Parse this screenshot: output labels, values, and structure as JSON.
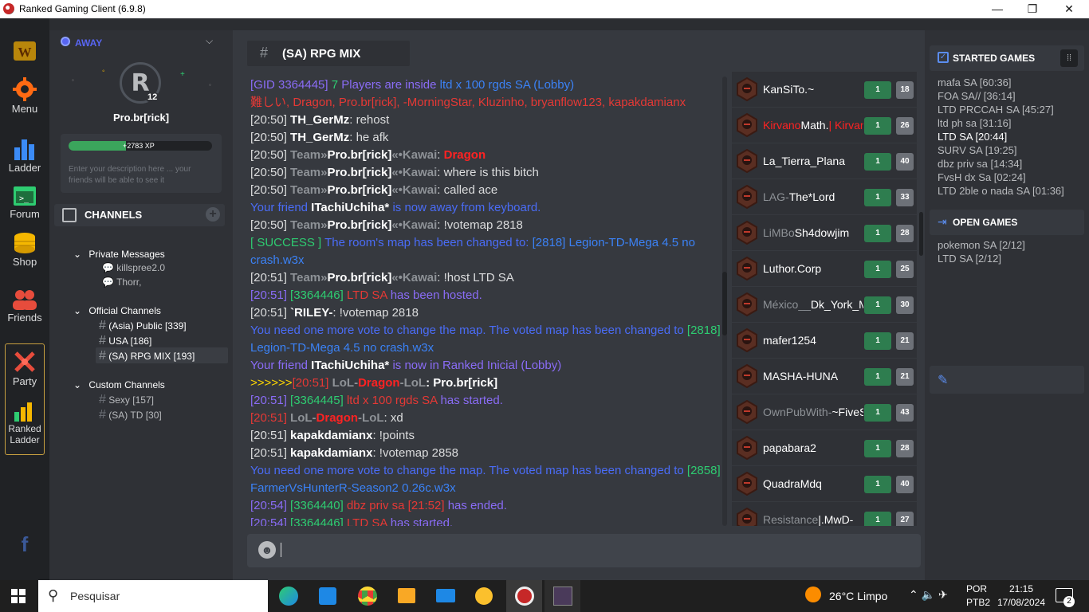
{
  "window": {
    "title": "Ranked Gaming Client (6.9.8)",
    "controls": [
      "—",
      "❐",
      "✕"
    ]
  },
  "nav": {
    "menu_label": "Menu",
    "ladder_label": "Ladder",
    "forum_label": "Forum",
    "shop_label": "Shop",
    "friends_label": "Friends",
    "party_label": "Party",
    "ranked_ladder_label_1": "Ranked",
    "ranked_ladder_label_2": "Ladder"
  },
  "profile": {
    "status": "AWAY",
    "name": "Pro.br[rick]",
    "level": "12",
    "xp": "+2783 XP",
    "xp_fraction": 0.4,
    "description_placeholder": "Enter your description here ... your friends will be able to see it"
  },
  "channels": {
    "header": "CHANNELS",
    "private_header": "Private Messages",
    "private": [
      "killspree2.0",
      "Thorr,"
    ],
    "official_header": "Official Channels",
    "official": [
      "(Asia) Public [339]",
      "USA [186]",
      "(SA) RPG MIX [193]"
    ],
    "custom_header": "Custom Channels",
    "custom": [
      "Sexy [157]",
      "(SA) TD [30]"
    ]
  },
  "chat": {
    "tab_title": "(SA) RPG MIX",
    "l1_a": "[GID 3364445]",
    "l1_b": "7",
    "l1_c": "Players are inside",
    "l1_d": "ltd x 100 rgds SA (Lobby)",
    "l2": "難しい, Dragon, Pro.br[rick], -MorningStar, Kluzinho, bryanflow123, kapakdamianx",
    "l3_t": "[20:50]",
    "l3_n": "TH_GerMz",
    "l3_m": ": rehost",
    "l4_t": "[20:50]",
    "l4_n": "TH_GerMz",
    "l4_m": ": he afk",
    "team": "Team»",
    "me": "Pro.br[rick]",
    "kawai": "«•Kawai",
    "l5_t": "[20:50]",
    "l5_m": "Dragon",
    "l6_t": "[20:50]",
    "l6_m": ": where is this bitch",
    "l7_t": "[20:50]",
    "l7_m": ": called ace",
    "l8_a": "Your friend",
    "l8_n": "ITachiUchiha*",
    "l8_b": "is now away from keyboard.",
    "l9_t": "[20:50]",
    "l9_m": ": !votemap 2818",
    "l10_a": "[ SUCCESS ]",
    "l10_b": "The room's map has been changed to:",
    "l10_c": "[2818] Legion-TD-Mega 4.5 no crash.w3x",
    "l11_t": "[20:51]",
    "l11_m": ": !host LTD SA",
    "l12_t": "[20:51]",
    "l12_g": "[3364446]",
    "l12_n": "LTD SA",
    "l12_m": "has been hosted.",
    "l13_t": "[20:51]",
    "l13_n": "`RILEY-",
    "l13_m": ": !votemap 2818",
    "l14_a": "You need one more vote to change the map. The voted map has been changed to",
    "l14_b": "[2818]",
    "l14_c": "Legion-TD-Mega 4.5 no crash.w3x",
    "l15_a": "Your friend",
    "l15_n": "ITachiUchiha*",
    "l15_b": "is now in Ranked Inicial (Lobby)",
    "l16_a": ">>>>>>",
    "l16_t": "[20:51]",
    "l16_n1": "LoL-",
    "l16_n2": "Dragon",
    "l16_n3": "-LoL",
    "l16_m": ": Pro.br[rick]",
    "l17_t": "[20:51]",
    "l17_g": "[3364445]",
    "l17_n": "ltd x 100 rgds SA",
    "l17_m": "has started.",
    "l18_t": "[20:51]",
    "l18_n1": "LoL-",
    "l18_n2": "Dragon",
    "l18_n3": "-LoL",
    "l18_m": ": xd",
    "l19_t": "[20:51]",
    "l19_n": "kapakdamianx",
    "l19_m": ": !points",
    "l20_t": "[20:51]",
    "l20_n": "kapakdamianx",
    "l20_m": ": !votemap 2858",
    "l21_a": "You need one more vote to change the map. The voted map has been changed to",
    "l21_b": "[2858]",
    "l21_c": "FarmerVsHunterR-Season2 0.26c.w3x",
    "l22_t": "[20:54]",
    "l22_g": "[3364440]",
    "l22_n": "dbz priv sa [21:52]",
    "l22_m": "has ended.",
    "l23_t": "[20:54]",
    "l23_g": "[3364446]",
    "l23_n": "LTD SA",
    "l23_m": "has started."
  },
  "users": [
    {
      "name": "KanSiTo.~",
      "a": "1",
      "b": "18"
    },
    {
      "name_red": "Kirvano",
      "name": "Math.",
      "name_red2": "| Kirvan",
      "a": "1",
      "b": "26"
    },
    {
      "name": "La_Tierra_Plana",
      "a": "1",
      "b": "40"
    },
    {
      "name_gray": "LAG-",
      "name": "The*Lord",
      "a": "1",
      "b": "33"
    },
    {
      "name_gray": "LiMBo",
      "name": "Sh4dowjim",
      "a": "1",
      "b": "28"
    },
    {
      "name": "Luthor.Corp",
      "a": "1",
      "b": "25"
    },
    {
      "name_gray": "México__",
      "name": "Dk_York_M",
      "a": "1",
      "b": "30"
    },
    {
      "name": "mafer1254",
      "a": "1",
      "b": "21"
    },
    {
      "name": "MASHA-HUNA",
      "a": "1",
      "b": "21"
    },
    {
      "name_gray": "OwnPubWith-",
      "name": "~FiveS",
      "a": "1",
      "b": "43"
    },
    {
      "name": "papabara2",
      "a": "1",
      "b": "28"
    },
    {
      "name": "QuadraMdq",
      "a": "1",
      "b": "40"
    },
    {
      "name_gray": "Resistance",
      "name": "|.MwD-",
      "a": "1",
      "b": "27"
    }
  ],
  "started_games": {
    "header": "STARTED GAMES",
    "items": [
      "mafa SA [60:36]",
      "FOA SA// [36:14]",
      "LTD PRCCAH SA [45:27]",
      "ltd ph sa [31:16]",
      "LTD SA [20:44]",
      "SURV SA [19:25]",
      "dbz priv sa [14:34]",
      "FvsH dx Sa [02:24]",
      "LTD 2ble o nada SA [01:36]"
    ]
  },
  "open_games": {
    "header": "OPEN GAMES",
    "items": [
      "pokemon SA [2/12]",
      "LTD SA [2/12]"
    ]
  },
  "taskbar": {
    "search": "Pesquisar",
    "weather": "26°C  Limpo",
    "lang1": "POR",
    "lang2": "PTB2",
    "time": "21:15",
    "date": "17/08/2024",
    "notif": "2"
  },
  "colors": {
    "accent": "#3b82f6",
    "away": "#5865f2",
    "xp_bar": "#3ba55c",
    "level_green": "#2e7d4f"
  }
}
